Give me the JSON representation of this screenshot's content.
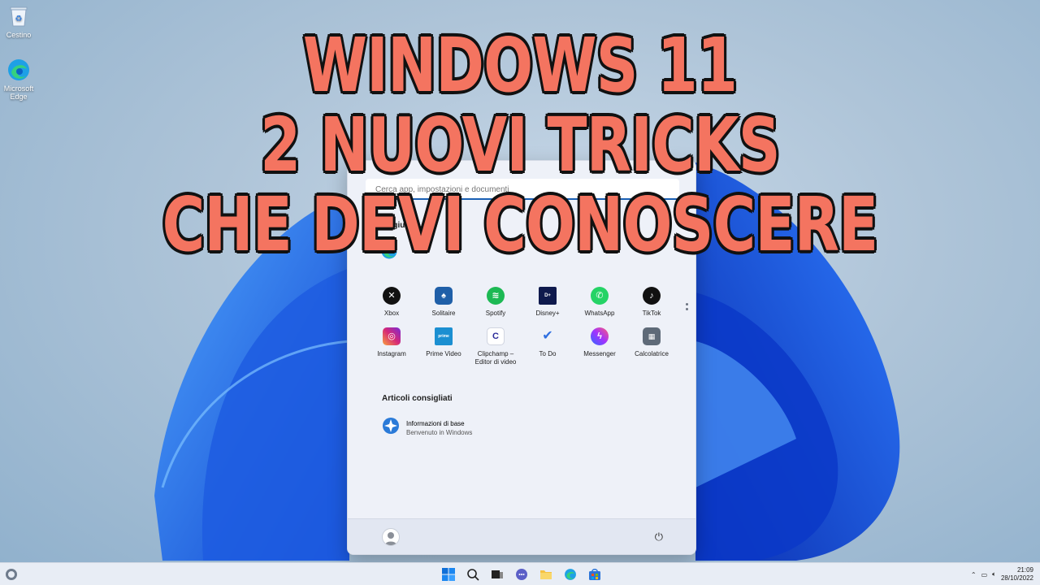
{
  "desktop": {
    "icons": [
      {
        "label": "Cestino",
        "icon": "recycle-bin-icon"
      },
      {
        "label": "Microsoft Edge",
        "icon": "edge-icon"
      }
    ]
  },
  "headline": {
    "line1": "WINDOWS 11",
    "line2": "2 NUOVI TRICKS",
    "line3": "CHE DEVI CONOSCERE"
  },
  "start_menu": {
    "search_placeholder": "Cerca app, impostazioni e documenti",
    "pinned_label": "Aggiunte",
    "pinned_first": [
      {
        "label": "Edge",
        "icon": "edge-icon"
      }
    ],
    "apps": [
      {
        "label": "Xbox",
        "icon": "xbox-icon",
        "color": "#111111"
      },
      {
        "label": "Solitaire",
        "icon": "solitaire-icon",
        "color": "#1f5fa8"
      },
      {
        "label": "Spotify",
        "icon": "spotify-icon",
        "color": "#1db954"
      },
      {
        "label": "Disney+",
        "icon": "disney-icon",
        "color": "#0f1a4d"
      },
      {
        "label": "WhatsApp",
        "icon": "whatsapp-icon",
        "color": "#25d366"
      },
      {
        "label": "TikTok",
        "icon": "tiktok-icon",
        "color": "#111111"
      },
      {
        "label": "Instagram",
        "icon": "instagram-icon",
        "color": "#d62976"
      },
      {
        "label": "Prime Video",
        "icon": "prime-video-icon",
        "color": "#1b8fd1"
      },
      {
        "label": "Clipchamp – Editor di video",
        "icon": "clipchamp-icon",
        "color": "#ffffff"
      },
      {
        "label": "To Do",
        "icon": "todo-icon",
        "color": "#ffffff"
      },
      {
        "label": "Messenger",
        "icon": "messenger-icon",
        "color": "#a033ff"
      },
      {
        "label": "Calcolatrice",
        "icon": "calculator-icon",
        "color": "#5e6a78"
      }
    ],
    "recommended_label": "Articoli consigliati",
    "recommended": [
      {
        "title": "Informazioni di base",
        "subtitle": "Benvenuto in Windows",
        "icon": "tips-icon"
      }
    ]
  },
  "taskbar": {
    "time": "21:09",
    "date": "28/10/2022",
    "items": [
      "start-icon",
      "search-icon",
      "task-view-icon",
      "chat-icon",
      "file-explorer-icon",
      "edge-icon",
      "store-icon"
    ]
  }
}
